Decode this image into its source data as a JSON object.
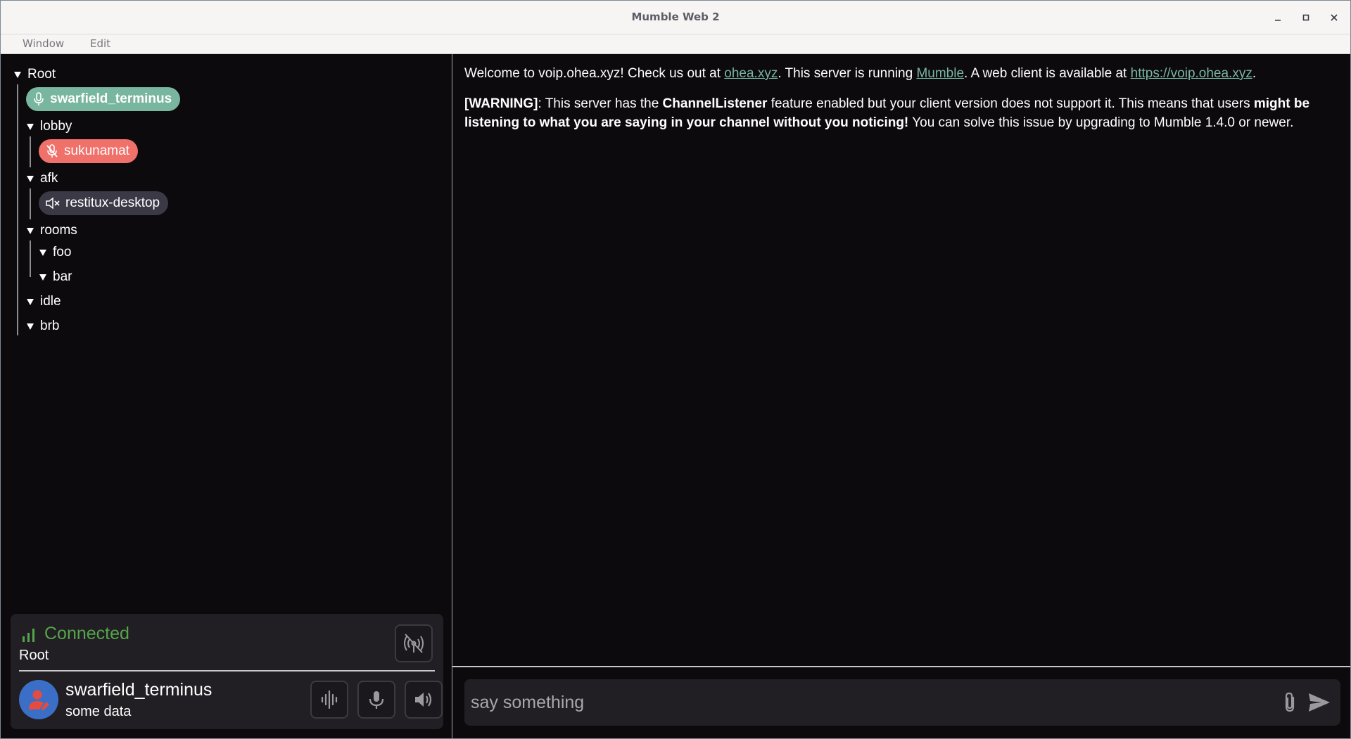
{
  "window": {
    "title": "Mumble Web 2"
  },
  "menubar": {
    "items": [
      "Window",
      "Edit"
    ]
  },
  "channel_tree": {
    "root": "Root",
    "root_user": "swarfield_terminus",
    "channels": [
      {
        "name": "lobby",
        "user": "sukunamat"
      },
      {
        "name": "afk",
        "user": "restitux-desktop"
      },
      {
        "name": "rooms",
        "subchannels": [
          "foo",
          "bar"
        ]
      },
      {
        "name": "idle"
      },
      {
        "name": "brb"
      }
    ]
  },
  "status": {
    "connection": "Connected",
    "channel": "Root",
    "username": "swarfield_terminus",
    "comment": "some data"
  },
  "chat": {
    "welcome": {
      "t1": "Welcome to voip.ohea.xyz! Check us out at ",
      "link1": "ohea.xyz",
      "t2": ". This server is running ",
      "link2": "Mumble",
      "t3": ". A web client is available at ",
      "link3": "https://voip.ohea.xyz",
      "t4": "."
    },
    "warning": {
      "tag": "[WARNING]",
      "t1": ": This server has the ",
      "feature": "ChannelListener",
      "t2": " feature enabled but your client version does not support it. This means that users ",
      "bold": "might be listening to what you are saying in your channel without you noticing!",
      "t3": " You can solve this issue by upgrading to Mumble 1.4.0 or newer."
    },
    "input_placeholder": "say something",
    "input_value": ""
  },
  "colors": {
    "accent": "#79b6a0",
    "connected": "#54a64a",
    "muted_user": "#f0706a",
    "deafened_user": "#3b3946",
    "background": "#0c0a0d"
  },
  "icons": {
    "window_controls": [
      "minimize-icon",
      "maximize-icon",
      "close-icon"
    ],
    "status": [
      "signal-bars-icon",
      "broadcast-off-icon"
    ],
    "controls": [
      "voice-activity-icon",
      "microphone-icon",
      "speaker-icon"
    ],
    "chat": [
      "paperclip-icon",
      "send-icon"
    ]
  }
}
